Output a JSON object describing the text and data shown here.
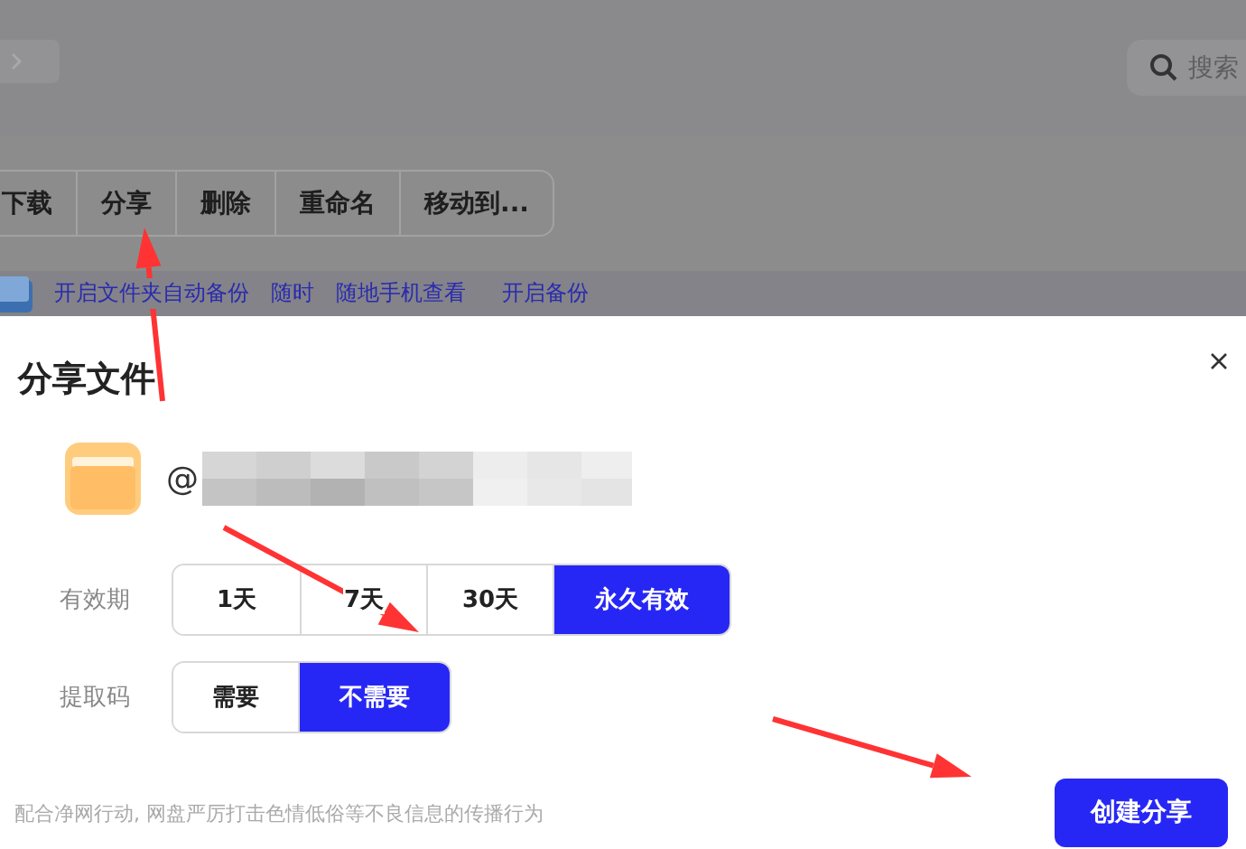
{
  "background": {
    "search": {
      "placeholder": "搜索"
    },
    "toolbar": [
      "下载",
      "分享",
      "删除",
      "重命名",
      "移动到..."
    ],
    "banner": [
      "开启文件夹自动备份",
      "随时",
      "随地手机查看",
      "开启备份"
    ]
  },
  "dialog": {
    "title": "分享文件",
    "file_name": "@",
    "validity": {
      "label": "有效期",
      "options": [
        {
          "label": "1天",
          "selected": false
        },
        {
          "label": "7天",
          "selected": false
        },
        {
          "label": "30天",
          "selected": false
        },
        {
          "label": "永久有效",
          "selected": true
        }
      ]
    },
    "code": {
      "label": "提取码",
      "options": [
        {
          "label": "需要",
          "selected": false
        },
        {
          "label": "不需要",
          "selected": true
        }
      ]
    },
    "notice": "配合净网行动, 网盘严厉打击色情低俗等不良信息的传播行为",
    "submit": "创建分享"
  }
}
